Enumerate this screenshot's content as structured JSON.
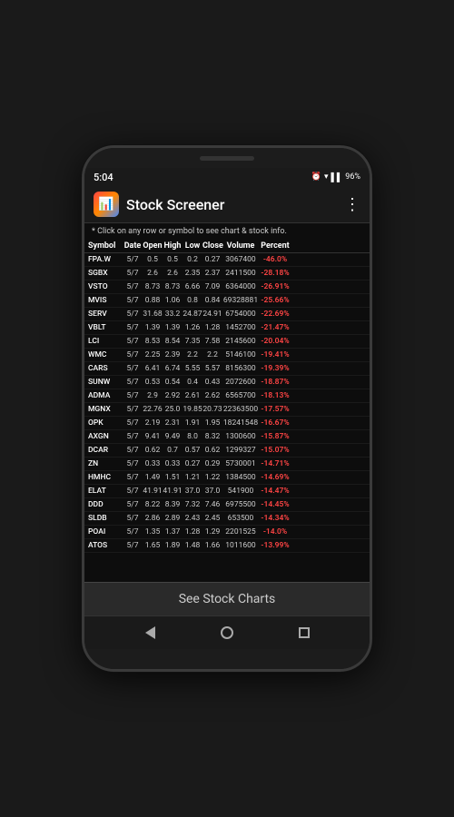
{
  "status": {
    "time": "5:04",
    "battery": "96%"
  },
  "header": {
    "title": "Stock Screener",
    "menu_label": "⋮"
  },
  "hint": "* Click on any row or symbol to see chart & stock info.",
  "table": {
    "columns": [
      "Symbol",
      "Date",
      "Open",
      "High",
      "Low",
      "Close",
      "Volume",
      "Percent"
    ],
    "rows": [
      {
        "symbol": "FPA.W",
        "date": "5/7",
        "open": "0.5",
        "high": "0.5",
        "low": "0.2",
        "close": "0.27",
        "volume": "3067400",
        "percent": "-46.0%"
      },
      {
        "symbol": "SGBX",
        "date": "5/7",
        "open": "2.6",
        "high": "2.6",
        "low": "2.35",
        "close": "2.37",
        "volume": "2411500",
        "percent": "-28.18%"
      },
      {
        "symbol": "VSTO",
        "date": "5/7",
        "open": "8.73",
        "high": "8.73",
        "low": "6.66",
        "close": "7.09",
        "volume": "6364000",
        "percent": "-26.91%"
      },
      {
        "symbol": "MVIS",
        "date": "5/7",
        "open": "0.88",
        "high": "1.06",
        "low": "0.8",
        "close": "0.84",
        "volume": "69328881",
        "percent": "-25.66%"
      },
      {
        "symbol": "SERV",
        "date": "5/7",
        "open": "31.68",
        "high": "33.2",
        "low": "24.87",
        "close": "24.91",
        "volume": "6754000",
        "percent": "-22.69%"
      },
      {
        "symbol": "VBLT",
        "date": "5/7",
        "open": "1.39",
        "high": "1.39",
        "low": "1.26",
        "close": "1.28",
        "volume": "1452700",
        "percent": "-21.47%"
      },
      {
        "symbol": "LCI",
        "date": "5/7",
        "open": "8.53",
        "high": "8.54",
        "low": "7.35",
        "close": "7.58",
        "volume": "2145600",
        "percent": "-20.04%"
      },
      {
        "symbol": "WMC",
        "date": "5/7",
        "open": "2.25",
        "high": "2.39",
        "low": "2.2",
        "close": "2.2",
        "volume": "5146100",
        "percent": "-19.41%"
      },
      {
        "symbol": "CARS",
        "date": "5/7",
        "open": "6.41",
        "high": "6.74",
        "low": "5.55",
        "close": "5.57",
        "volume": "8156300",
        "percent": "-19.39%"
      },
      {
        "symbol": "SUNW",
        "date": "5/7",
        "open": "0.53",
        "high": "0.54",
        "low": "0.4",
        "close": "0.43",
        "volume": "2072600",
        "percent": "-18.87%"
      },
      {
        "symbol": "ADMA",
        "date": "5/7",
        "open": "2.9",
        "high": "2.92",
        "low": "2.61",
        "close": "2.62",
        "volume": "6565700",
        "percent": "-18.13%"
      },
      {
        "symbol": "MGNX",
        "date": "5/7",
        "open": "22.76",
        "high": "25.0",
        "low": "19.85",
        "close": "20.73",
        "volume": "22363500",
        "percent": "-17.57%"
      },
      {
        "symbol": "OPK",
        "date": "5/7",
        "open": "2.19",
        "high": "2.31",
        "low": "1.91",
        "close": "1.95",
        "volume": "18241548",
        "percent": "-16.67%"
      },
      {
        "symbol": "AXGN",
        "date": "5/7",
        "open": "9.41",
        "high": "9.49",
        "low": "8.0",
        "close": "8.32",
        "volume": "1300600",
        "percent": "-15.87%"
      },
      {
        "symbol": "DCAR",
        "date": "5/7",
        "open": "0.62",
        "high": "0.7",
        "low": "0.57",
        "close": "0.62",
        "volume": "1299327",
        "percent": "-15.07%"
      },
      {
        "symbol": "ZN",
        "date": "5/7",
        "open": "0.33",
        "high": "0.33",
        "low": "0.27",
        "close": "0.29",
        "volume": "5730001",
        "percent": "-14.71%"
      },
      {
        "symbol": "HMHC",
        "date": "5/7",
        "open": "1.49",
        "high": "1.51",
        "low": "1.21",
        "close": "1.22",
        "volume": "1384500",
        "percent": "-14.69%"
      },
      {
        "symbol": "ELAT",
        "date": "5/7",
        "open": "41.91",
        "high": "41.91",
        "low": "37.0",
        "close": "37.0",
        "volume": "541900",
        "percent": "-14.47%"
      },
      {
        "symbol": "DDD",
        "date": "5/7",
        "open": "8.22",
        "high": "8.39",
        "low": "7.32",
        "close": "7.46",
        "volume": "6975500",
        "percent": "-14.45%"
      },
      {
        "symbol": "SLDB",
        "date": "5/7",
        "open": "2.86",
        "high": "2.89",
        "low": "2.43",
        "close": "2.45",
        "volume": "653500",
        "percent": "-14.34%"
      },
      {
        "symbol": "POAI",
        "date": "5/7",
        "open": "1.35",
        "high": "1.37",
        "low": "1.28",
        "close": "1.29",
        "volume": "2201525",
        "percent": "-14.0%"
      },
      {
        "symbol": "ATOS",
        "date": "5/7",
        "open": "1.65",
        "high": "1.89",
        "low": "1.48",
        "close": "1.66",
        "volume": "1011600",
        "percent": "-13.99%"
      }
    ]
  },
  "see_charts_label": "See Stock Charts",
  "nav": {
    "back": "◀",
    "home": "",
    "recent": ""
  }
}
